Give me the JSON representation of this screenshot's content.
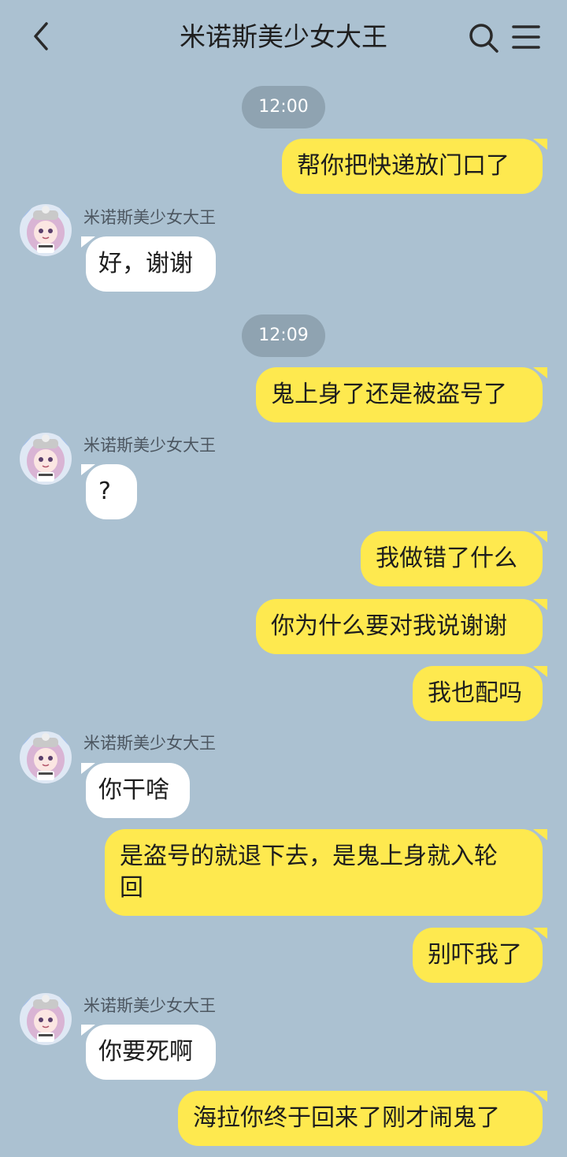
{
  "header": {
    "title": "米诺斯美少女大王",
    "icons": [
      "chevron-left-icon",
      "search-icon",
      "menu-icon"
    ]
  },
  "colors": {
    "background": "#abc1d1",
    "outgoing_bubble": "#fee94f",
    "incoming_bubble": "#ffffff",
    "time_pill": "#8fa3b1"
  },
  "messages": [
    {
      "type": "time",
      "text": "12:00"
    },
    {
      "type": "out",
      "text": "帮你把快递放门口了"
    },
    {
      "type": "in",
      "sender": "米诺斯美少女大王",
      "text": "好，谢谢"
    },
    {
      "type": "time",
      "text": "12:09"
    },
    {
      "type": "out",
      "text": "鬼上身了还是被盗号了"
    },
    {
      "type": "in",
      "sender": "米诺斯美少女大王",
      "text": "?"
    },
    {
      "type": "out",
      "text": "我做错了什么"
    },
    {
      "type": "out",
      "text": "你为什么要对我说谢谢"
    },
    {
      "type": "out",
      "text": "我也配吗"
    },
    {
      "type": "in",
      "sender": "米诺斯美少女大王",
      "text": "你干啥"
    },
    {
      "type": "out",
      "text": "是盗号的就退下去，是鬼上身就入轮回"
    },
    {
      "type": "out",
      "text": "别吓我了"
    },
    {
      "type": "in",
      "sender": "米诺斯美少女大王",
      "text": "你要死啊"
    },
    {
      "type": "out",
      "text": "海拉你终于回来了刚才闹鬼了"
    }
  ]
}
